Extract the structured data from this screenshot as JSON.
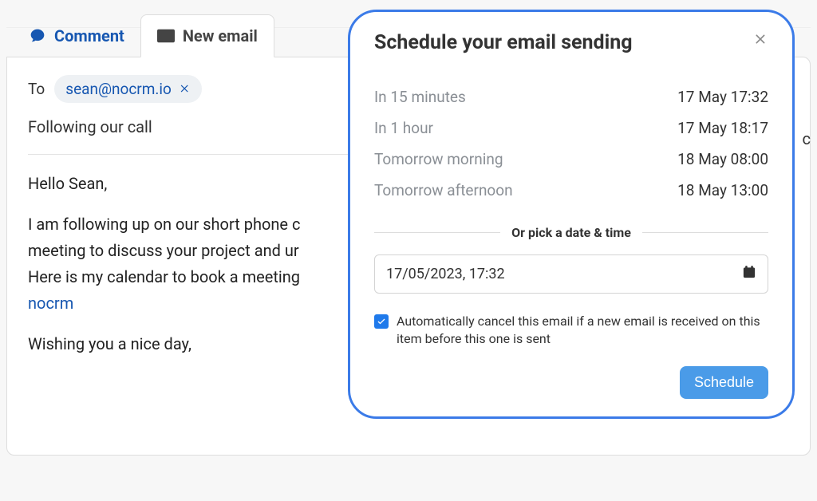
{
  "tabs": {
    "comment": "Comment",
    "new_email": "New email"
  },
  "compose": {
    "to_label": "To",
    "recipient": "sean@nocrm.io",
    "subject": "Following our call",
    "body": {
      "greeting": "Hello Sean,",
      "line1": "I am following up on our short phone c",
      "line2": "meeting to discuss your project and ur",
      "line3_prefix": "Here is my calendar to book a meeting",
      "link_text": "nocrm",
      "signoff": "Wishing you a nice day,"
    }
  },
  "popover": {
    "title": "Schedule your email sending",
    "options": [
      {
        "label": "In 15 minutes",
        "time": "17 May 17:32"
      },
      {
        "label": "In 1 hour",
        "time": "17 May 18:17"
      },
      {
        "label": "Tomorrow morning",
        "time": "18 May 08:00"
      },
      {
        "label": "Tomorrow afternoon",
        "time": "18 May 13:00"
      }
    ],
    "or_label": "Or pick a date & time",
    "datetime_value": "17/05/2023, 17:32",
    "auto_cancel_label": "Automatically cancel this email if a new email is received on this item before this one is sent",
    "auto_cancel_checked": true,
    "schedule_button": "Schedule"
  },
  "bg_letter": "c"
}
